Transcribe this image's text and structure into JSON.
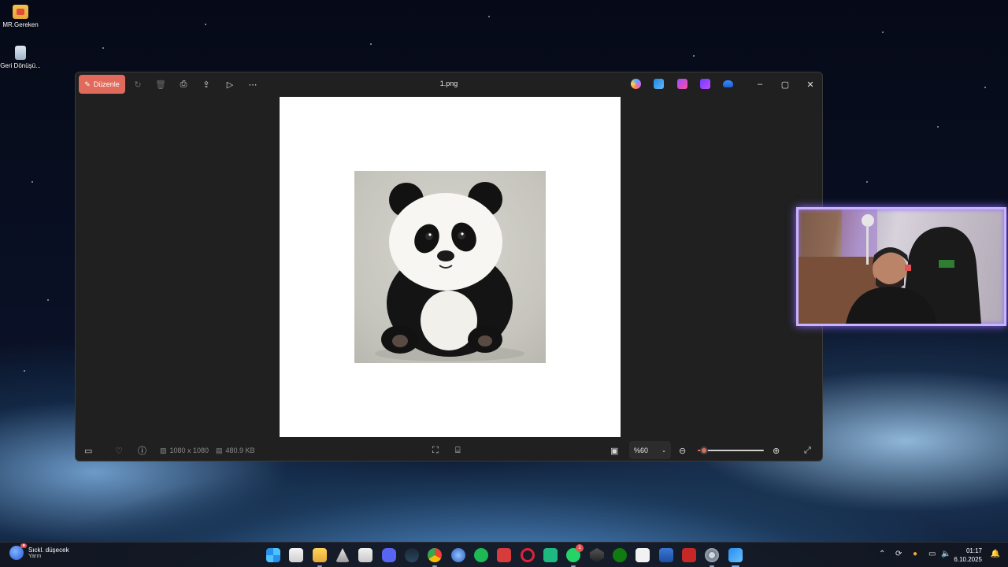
{
  "desktop": {
    "icons": [
      {
        "label": "MR.Gereken",
        "icon": "folder-red-icon"
      },
      {
        "label": "Geri Dönüşü...",
        "icon": "recycle-bin-icon"
      }
    ]
  },
  "viewer": {
    "edit_label": "Düzenle",
    "file_title": "1.png",
    "toolbar_icons": [
      "rotate-icon",
      "delete-icon",
      "print-icon",
      "share-icon",
      "slideshow-icon",
      "more-icon"
    ],
    "right_apps": [
      "copilot-icon",
      "photos-editor-icon",
      "clipchamp-icon",
      "designer-icon",
      "onedrive-icon"
    ],
    "window_controls": [
      "minimize-icon",
      "maximize-icon",
      "close-icon"
    ],
    "image_subject": "panda",
    "dimensions": "1080 x 1080",
    "file_size": "480.9 KB",
    "zoom_label": "%60",
    "zoom_fraction": 0.1
  },
  "taskbar": {
    "weather_line1": "Sıckl. düşecek",
    "weather_line2": "Yarın",
    "apps": [
      "windows-start-icon",
      "microsoft-store-icon",
      "file-explorer-icon",
      "app-icon",
      "app-icon",
      "discord-icon",
      "steam-icon",
      "chrome-icon",
      "app-icon",
      "spotify-icon",
      "app-icon",
      "opera-icon",
      "app-icon",
      "whatsapp-icon",
      "app-icon",
      "xbox-icon",
      "capcut-icon",
      "app-icon",
      "app-icon",
      "settings-icon",
      "photos-icon"
    ],
    "whatsapp_badge": "1",
    "time": "01:17",
    "date": "6.10.2025"
  }
}
